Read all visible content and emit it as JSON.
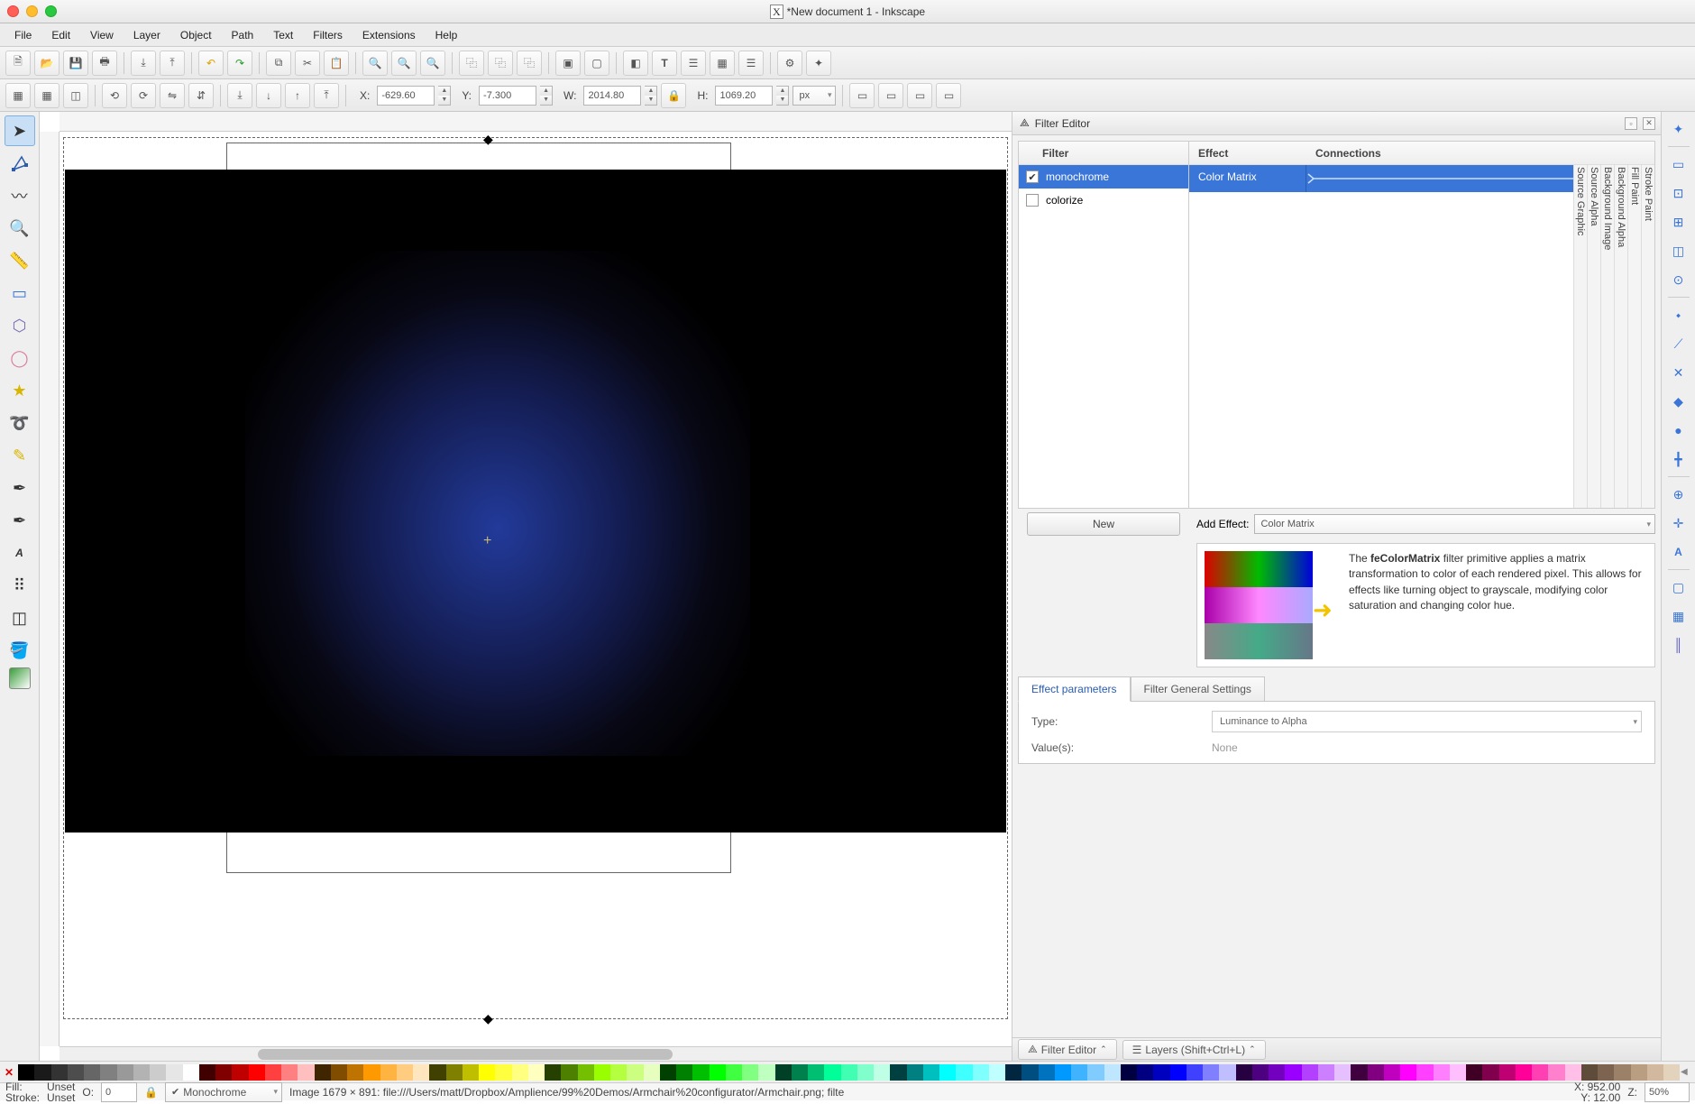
{
  "window": {
    "title": "*New document 1 - Inkscape"
  },
  "menu": [
    "File",
    "Edit",
    "View",
    "Layer",
    "Object",
    "Path",
    "Text",
    "Filters",
    "Extensions",
    "Help"
  ],
  "coords": {
    "x_label": "X:",
    "x": "-629.60",
    "y_label": "Y:",
    "y": "-7.300",
    "w_label": "W:",
    "w": "2014.80",
    "h_label": "H:",
    "h": "1069.20",
    "unit": "px"
  },
  "panel": {
    "title": "Filter Editor",
    "filter_col": "Filter",
    "effect_col": "Effect",
    "conn_col": "Connections",
    "filters": [
      {
        "name": "monochrome",
        "checked": true
      },
      {
        "name": "colorize",
        "checked": false
      }
    ],
    "effect_row": "Color Matrix",
    "sources": [
      "Source Graphic",
      "Source Alpha",
      "Background Image",
      "Background Alpha",
      "Fill Paint",
      "Stroke Paint"
    ],
    "new_btn": "New",
    "add_effect_label": "Add Effect:",
    "add_effect_value": "Color Matrix",
    "desc_html": "The feColorMatrix filter primitive applies a matrix transformation to color of each rendered pixel. This allows for effects like turning object to grayscale, modifying color saturation and changing color hue.",
    "tabs": [
      "Effect parameters",
      "Filter General Settings"
    ],
    "type_label": "Type:",
    "type_value": "Luminance to Alpha",
    "values_label": "Value(s):",
    "values_value": "None",
    "bottom_tabs": [
      "Filter Editor",
      "Layers (Shift+Ctrl+L)"
    ]
  },
  "status": {
    "fill_label": "Fill:",
    "stroke_label": "Stroke:",
    "fill": "Unset",
    "stroke": "Unset",
    "opacity_label": "O:",
    "opacity": "0",
    "layer": "Monochrome",
    "info": "Image  1679 × 891: file:///Users/matt/Dropbox/Amplience/99%20Demos/Armchair%20configurator/Armchair.png; filte",
    "cx_label": "X:",
    "cx": "952.00",
    "cy_label": "Y:",
    "cy": "12.00",
    "z_label": "Z:",
    "z": "50%"
  },
  "palette_colors": [
    "#000000",
    "#1a1a1a",
    "#333333",
    "#4d4d4d",
    "#666666",
    "#808080",
    "#999999",
    "#b3b3b3",
    "#cccccc",
    "#e6e6e6",
    "#ffffff",
    "#400000",
    "#800000",
    "#bf0000",
    "#ff0000",
    "#ff4040",
    "#ff8080",
    "#ffbfbf",
    "#402600",
    "#804d00",
    "#bf7300",
    "#ff9900",
    "#ffb340",
    "#ffcc80",
    "#ffe6bf",
    "#404000",
    "#808000",
    "#bfbf00",
    "#ffff00",
    "#ffff40",
    "#ffff80",
    "#ffffbf",
    "#264000",
    "#4d8000",
    "#73bf00",
    "#99ff00",
    "#b3ff40",
    "#ccff80",
    "#e6ffbf",
    "#004000",
    "#008000",
    "#00bf00",
    "#00ff00",
    "#40ff40",
    "#80ff80",
    "#bfffbf",
    "#004026",
    "#00804d",
    "#00bf73",
    "#00ff99",
    "#40ffb3",
    "#80ffcc",
    "#bfffe6",
    "#004040",
    "#008080",
    "#00bfbf",
    "#00ffff",
    "#40ffff",
    "#80ffff",
    "#bfffff",
    "#002640",
    "#004d80",
    "#0073bf",
    "#0099ff",
    "#40b3ff",
    "#80ccff",
    "#bfe6ff",
    "#000040",
    "#000080",
    "#0000bf",
    "#0000ff",
    "#4040ff",
    "#8080ff",
    "#bfbfff",
    "#260040",
    "#4d0080",
    "#7300bf",
    "#9900ff",
    "#b340ff",
    "#cc80ff",
    "#e6bfff",
    "#400040",
    "#800080",
    "#bf00bf",
    "#ff00ff",
    "#ff40ff",
    "#ff80ff",
    "#ffbfff",
    "#400026",
    "#80004d",
    "#bf0073",
    "#ff0099",
    "#ff40b3",
    "#ff80cc",
    "#ffbfe6",
    "#5f4b3a",
    "#7d6450",
    "#9b8168",
    "#b99e82",
    "#d1b89e",
    "#e3d2bc"
  ]
}
